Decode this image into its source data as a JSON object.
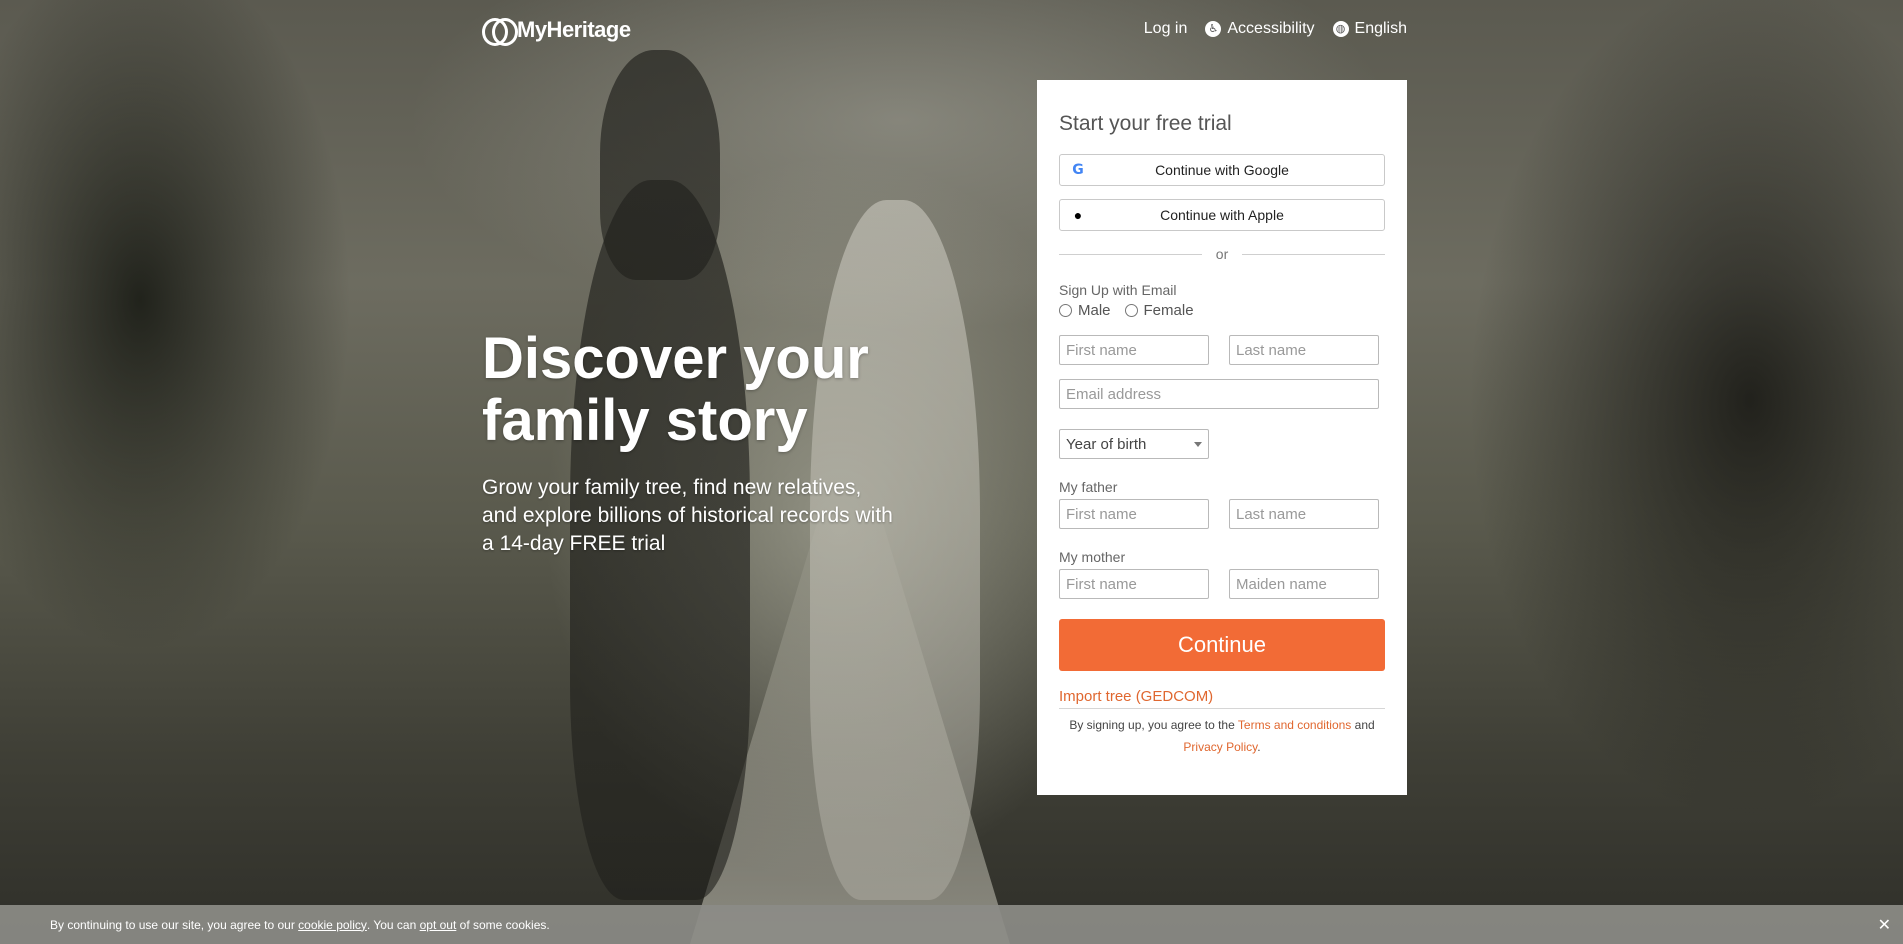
{
  "header": {
    "logo_text": "MyHeritage",
    "nav": {
      "login": "Log in",
      "accessibility": "Accessibility",
      "language": "English"
    }
  },
  "hero": {
    "title_line1": "Discover your",
    "title_line2": "family story",
    "subtitle_line1": "Grow your family tree, find new relatives,",
    "subtitle_line2": "and explore billions of historical records with",
    "subtitle_line3": "a 14-day FREE trial"
  },
  "signup": {
    "title": "Start your free trial",
    "google_label": "Continue with Google",
    "apple_label": "Continue with Apple",
    "divider": "or",
    "email_section": "Sign Up with Email",
    "gender_male": "Male",
    "gender_female": "Female",
    "first_name_placeholder": "First name",
    "last_name_placeholder": "Last name",
    "email_placeholder": "Email address",
    "year_of_birth": "Year of birth",
    "father_label": "My father",
    "father_first_placeholder": "First name",
    "father_last_placeholder": "Last name",
    "mother_label": "My mother",
    "mother_first_placeholder": "First name",
    "mother_maiden_placeholder": "Maiden name",
    "continue_label": "Continue",
    "import_label": "Import tree (GEDCOM)",
    "terms_prefix": "By signing up, you agree to the",
    "terms_link": "Terms and conditions",
    "terms_and": "and",
    "privacy_link": "Privacy Policy",
    "terms_suffix": "."
  },
  "cookie_bar": {
    "text1": "By continuing to use our site, you agree to our",
    "cookie_policy": "cookie policy",
    "text2": ". You can",
    "opt_out": "opt out",
    "text3": "of some cookies.",
    "close": "✕"
  },
  "colors": {
    "accent": "#f26b36",
    "link": "#e0672f"
  }
}
